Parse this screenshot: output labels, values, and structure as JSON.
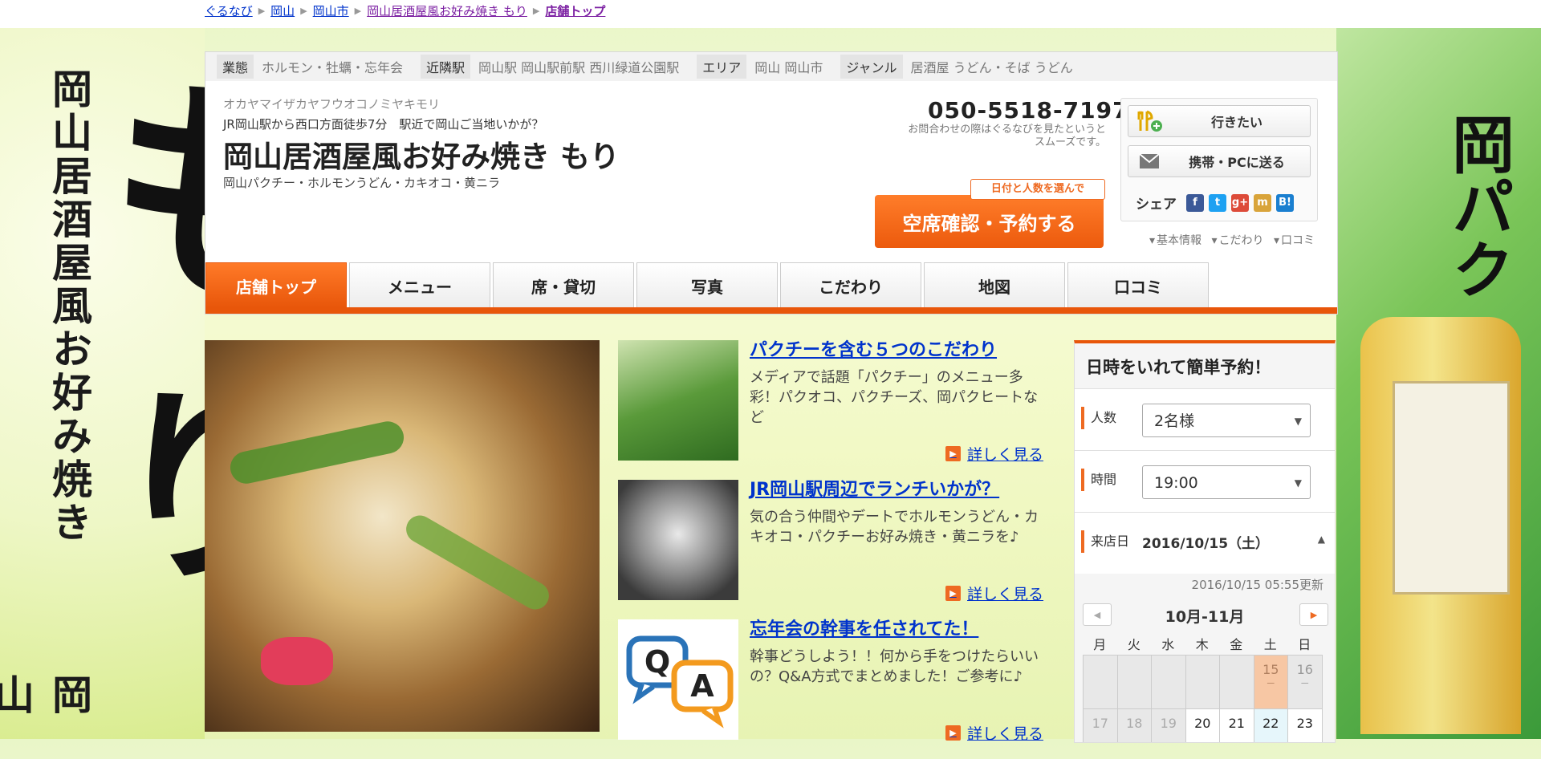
{
  "breadcrumb": [
    "ぐるなび",
    "岡山",
    "岡山市",
    "岡山居酒屋風お好み焼き もり",
    "店舗トップ"
  ],
  "background": {
    "vertical_title": "岡山居酒屋風お好み焼き",
    "vertical_title_2": "岡山",
    "brush_char_1": "も",
    "brush_char_2": "り",
    "right_brush": "岡パク"
  },
  "info_bar": [
    {
      "tag": "業態",
      "value": "ホルモン・牡蠣・忘年会"
    },
    {
      "tag": "近隣駅",
      "value": "岡山駅 岡山駅前駅 西川緑道公園駅"
    },
    {
      "tag": "エリア",
      "value": "岡山 岡山市"
    },
    {
      "tag": "ジャンル",
      "value": "居酒屋 うどん・そば うどん"
    }
  ],
  "shop": {
    "kana": "オカヤマイザカヤフウオコノミヤキモリ",
    "catch": "JR岡山駅から西口方面徒歩7分　駅近で岡山ご当地いかが？",
    "name": "岡山居酒屋風お好み焼き もり",
    "subline": "岡山パクチー・ホルモンうどん・カキオコ・黄ニラ"
  },
  "phone": {
    "number": "050-5518-7197",
    "note": "お問合わせの際はぐるなびを見たというとスムーズです。"
  },
  "buttons": {
    "want_to_go": "行きたい",
    "send_to_device": "携帯・PCに送る",
    "share_label": "シェア",
    "reserve_tip": "日付と人数を選んで",
    "reserve": "空席確認・予約する"
  },
  "share_icons": {
    "facebook": "f",
    "twitter": "t",
    "google": "g+",
    "mixi": "m",
    "hatena": "B!"
  },
  "jump_links": [
    "基本情報",
    "こだわり",
    "口コミ"
  ],
  "tabs": [
    "店舗トップ",
    "メニュー",
    "席・貸切",
    "写真",
    "こだわり",
    "地図",
    "口コミ"
  ],
  "features": [
    {
      "title": "パクチーを含む５つのこだわり",
      "text": "メディアで話題「パクチー」のメニュー多彩！パクオコ、パクチーズ、岡パクヒートなど",
      "more": "詳しく見る"
    },
    {
      "title": "JR岡山駅周辺でランチいかが？",
      "text": "気の合う仲間やデートでホルモンうどん・カキオコ・パクチーお好み焼き・黄ニラを♪",
      "more": "詳しく見る"
    },
    {
      "title": "忘年会の幹事を任されてた！",
      "text": "幹事どうしよう！！何から手をつけたらいいの？Q&A方式でまとめました！ご参考に♪",
      "more": "詳しく見る"
    }
  ],
  "reservation": {
    "title": "日時をいれて簡単予約！",
    "people_label": "人数",
    "people_value": "2名様",
    "time_label": "時間",
    "time_value": "19:00",
    "date_label": "来店日",
    "date_value": "2016/10/15（土）",
    "updated": "2016/10/15 05:55更新",
    "month": "10月-11月",
    "weekdays": [
      "月",
      "火",
      "水",
      "木",
      "金",
      "土",
      "日"
    ],
    "row1": [
      "",
      "",
      "",
      "",
      "",
      "15",
      "16"
    ],
    "row1_dash": [
      "",
      "",
      "",
      "",
      "",
      "－",
      "－"
    ],
    "row2": [
      "17",
      "18",
      "19",
      "20",
      "21",
      "22",
      "23"
    ]
  },
  "colors": {
    "accent": "#e8560a",
    "link": "#0033cc",
    "visited": "#7b1fa2"
  }
}
